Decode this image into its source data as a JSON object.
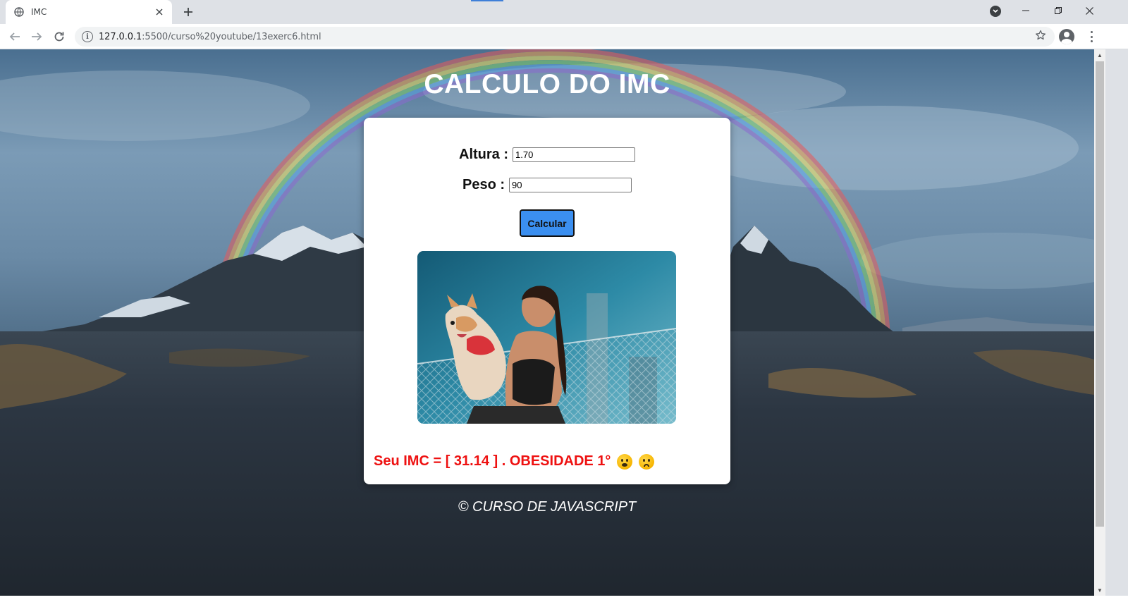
{
  "browser": {
    "tab_title": "IMC",
    "url_host": "127.0.0.1",
    "url_path": ":5500/curso%20youtube/13exerc6.html",
    "icons": {
      "favicon": "globe-icon",
      "tab_close": "close-icon",
      "new_tab": "plus-icon",
      "back": "back-arrow-icon",
      "forward": "forward-arrow-icon",
      "reload": "reload-icon",
      "site_info": "info-icon",
      "bookmark": "star-icon",
      "profile": "account-icon",
      "menu": "more-vert-icon",
      "tab_search": "chevron-down-icon",
      "minimize": "minimize-icon",
      "restore": "restore-icon",
      "close_window": "close-icon"
    }
  },
  "page": {
    "title": "CALCULO DO IMC",
    "form": {
      "height_label": "Altura :",
      "height_value": "1.70",
      "weight_label": "Peso :",
      "weight_value": "90",
      "button_label": "Calcular"
    },
    "result_text": "Seu IMC = [ 31.14 ] . OBESIDADE 1°",
    "result_color": "#ee1111",
    "button_color": "#3b8ff0",
    "footer": "© CURSO DE JAVASCRIPT"
  }
}
